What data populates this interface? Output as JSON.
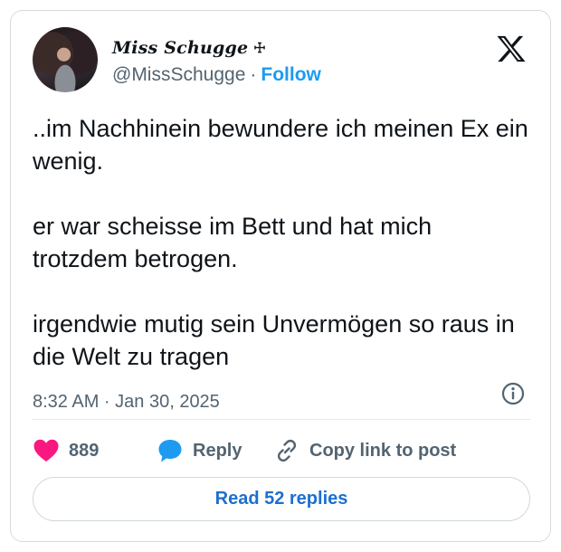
{
  "author": {
    "display_name": "Miss Schugge",
    "name_mark": "☩",
    "handle": "@MissSchugge",
    "separator": "·",
    "follow_label": "Follow"
  },
  "tweet": {
    "paragraphs": [
      "..im Nachhinein bewundere ich meinen Ex ein wenig.",
      "er war scheisse im Bett und hat mich trotzdem betrogen.",
      "irgendwie mutig sein Unvermögen so raus in die Welt zu tragen"
    ],
    "timestamp": "8:32 AM · Jan 30, 2025"
  },
  "actions": {
    "likes": "889",
    "reply_label": "Reply",
    "copy_link_label": "Copy link to post"
  },
  "read_replies_label": "Read 52 replies",
  "icons": {
    "logo": "x-logo-icon",
    "info": "info-icon",
    "like": "heart-icon",
    "reply": "speech-bubble-icon",
    "copy": "link-icon"
  },
  "colors": {
    "accent": "#1d9bf0",
    "like": "#f91880",
    "muted": "#536471",
    "text": "#0f1419"
  }
}
